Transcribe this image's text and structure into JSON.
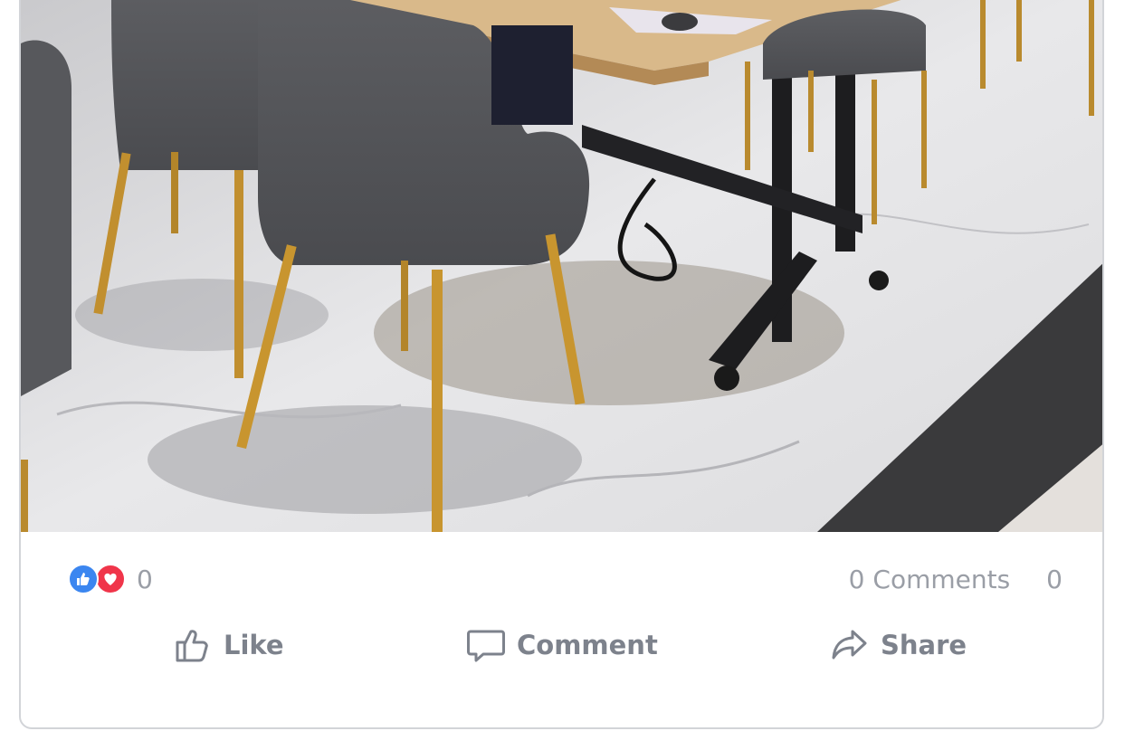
{
  "post": {
    "image_alt": "Photo of gray upholstered chairs with gold legs around a wooden table on a marble floor",
    "reactions": {
      "icons": [
        "like-reaction-icon",
        "love-reaction-icon"
      ],
      "count": "0",
      "colors": {
        "like": "#3b86f0",
        "love": "#f0354a"
      }
    },
    "comments_count_label": "0 Comments",
    "shares_count": "0",
    "actions": {
      "like": {
        "label": "Like",
        "icon": "thumbs-up-icon"
      },
      "comment": {
        "label": "Comment",
        "icon": "comment-bubble-icon"
      },
      "share": {
        "label": "Share",
        "icon": "share-arrow-icon"
      }
    }
  }
}
